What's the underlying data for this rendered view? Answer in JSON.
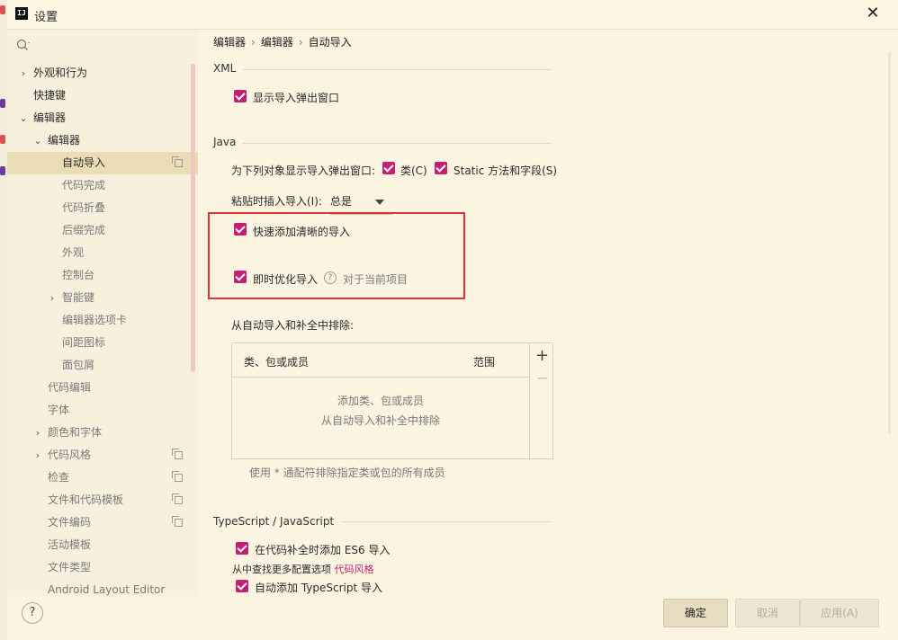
{
  "title": "设置",
  "search": {
    "placeholder": ""
  },
  "sidebar": {
    "items": [
      {
        "label": "外观和行为",
        "expander": "›"
      },
      {
        "label": "快捷键"
      },
      {
        "label": "编辑器",
        "expander": "⌄"
      },
      {
        "label": "编辑器",
        "expander": "⌄"
      },
      {
        "label": "自动导入",
        "selected": true
      },
      {
        "label": "代码完成"
      },
      {
        "label": "代码折叠"
      },
      {
        "label": "后缀完成"
      },
      {
        "label": "外观"
      },
      {
        "label": "控制台"
      },
      {
        "label": "智能键",
        "expander": "›"
      },
      {
        "label": "编辑器选项卡"
      },
      {
        "label": "间距图标"
      },
      {
        "label": "面包屑"
      },
      {
        "label": "代码编辑"
      },
      {
        "label": "字体"
      },
      {
        "label": "颜色和字体",
        "expander": "›"
      },
      {
        "label": "代码风格",
        "expander": "›"
      },
      {
        "label": "检查"
      },
      {
        "label": "文件和代码模板"
      },
      {
        "label": "文件编码"
      },
      {
        "label": "活动模板"
      },
      {
        "label": "文件类型"
      },
      {
        "label": "Android Layout Editor"
      }
    ]
  },
  "breadcrumb": {
    "part1": "编辑器",
    "part2": "编辑器",
    "part3": "自动导入",
    "separator": "›"
  },
  "xml": {
    "title": "XML",
    "show_popup": "显示导入弹出窗口"
  },
  "java": {
    "title": "Java",
    "popup_for": "为下列对象显示导入弹出窗口:",
    "classes": "类(C)",
    "static": "Static 方法和字段(S)",
    "paste_label": "粘贴时插入导入(I):",
    "paste_value": "总是",
    "add_unambiguous": "快速添加清晰的导入",
    "optimize": "即时优化导入",
    "optimize_scope": "对于当前项目",
    "exclude_label": "从自动导入和补全中排除:",
    "table": {
      "col1": "类、包或成员",
      "col2": "范围",
      "empty1": "添加类、包或成员",
      "empty2": "从自动导入和补全中排除"
    },
    "hint": "使用 * 通配符排除指定类或包的所有成员"
  },
  "ts": {
    "title": "TypeScript / JavaScript",
    "es6": "在代码补全时添加 ES6 导入",
    "more_prefix": "从中查找更多配置选项",
    "more_link": "代码风格",
    "auto_ts": "自动添加 TypeScript 导入"
  },
  "buttons": {
    "ok": "确定",
    "cancel": "取消",
    "apply": "应用(A)"
  },
  "help": "?",
  "colors": {
    "accent": "#c41f72",
    "highlight": "#e03333",
    "link": "#c41f72"
  }
}
